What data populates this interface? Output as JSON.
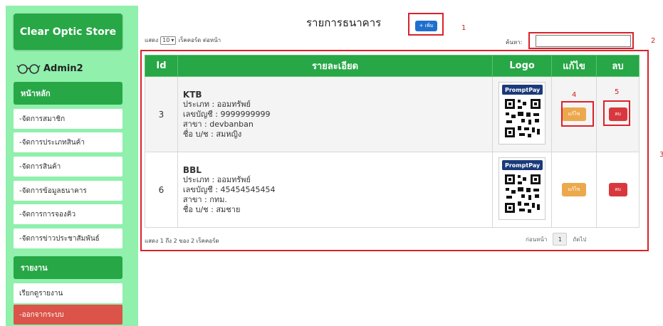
{
  "sidebar": {
    "brand": "Clear Optic Store",
    "user": "Admin2",
    "main_section": "หน้าหลัก",
    "main_items": [
      {
        "label": "-จัดการสมาชิก"
      },
      {
        "label": "-จัดการประเภทสินค้า"
      },
      {
        "label": "-จัดการสินค้า"
      },
      {
        "label": "-จัดการข้อมูลธนาคาร"
      },
      {
        "label": "-จัดการการจองคิว"
      },
      {
        "label": "-จัดการข่าวประชาสัมพันธ์"
      }
    ],
    "report_section": "รายงาน",
    "report_items": [
      {
        "label": "เรียกดูรายงาน"
      }
    ],
    "logout": "-ออกจากระบบ"
  },
  "main": {
    "title": "รายการธนาคาร",
    "add_button": "+ เพิ่ม",
    "length_prefix": "แสดง",
    "length_value": "10",
    "length_suffix": "เร็คคอร์ด ต่อหน้า",
    "search_label": "ค้นหา:",
    "search_value": "",
    "columns": [
      "Id",
      "รายละเอียด",
      "Logo",
      "แก้ไข",
      "ลบ"
    ],
    "rows": [
      {
        "id": "3",
        "bank": "KTB",
        "type": "ประเภท : ออมทรัพย์",
        "account": "เลขบัญชี : 9999999999",
        "branch": "สาขา : devbanban",
        "holder": "ชื่อ บ/ช : สมหญิง",
        "logo_text": "PromptPay",
        "edit": "แก้ไข",
        "delete": "ลบ"
      },
      {
        "id": "6",
        "bank": "BBL",
        "type": "ประเภท : ออมทรัพย์",
        "account": "เลขบัญชี : 45454545454",
        "branch": "สาขา : กทม.",
        "holder": "ชื่อ บ/ช : สมชาย",
        "logo_text": "PromptPay",
        "edit": "แก้ไข",
        "delete": "ลบ"
      }
    ],
    "info": "แสดง 1 ถึง 2 ของ 2 เร็คคอร์ด",
    "pager": {
      "prev": "ก่อนหน้า",
      "current": "1",
      "next": "ถัดไป"
    }
  },
  "annotations": [
    "1",
    "2",
    "3",
    "4",
    "5"
  ],
  "colors": {
    "green": "#27a746",
    "sidebar_bg": "#90f0ac",
    "highlight": "#d9232a",
    "edit": "#eca84c",
    "delete": "#d8383d",
    "primary": "#1f6fce"
  }
}
